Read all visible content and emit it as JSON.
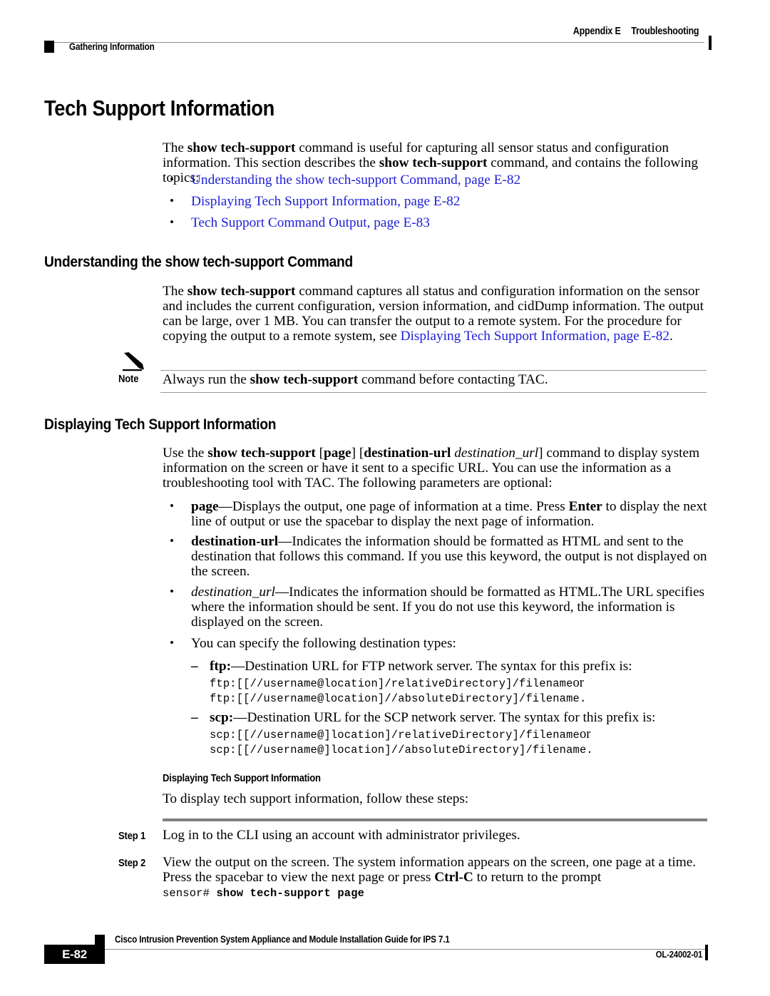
{
  "header": {
    "left_marker": "square-marker",
    "left_text": "Gathering Information",
    "right_appendix": "Appendix E",
    "right_title": "Troubleshooting"
  },
  "title": "Tech Support Information",
  "intro": {
    "line1_a": "The ",
    "line1_b": "show tech-support",
    "line1_c": " command is useful for capturing all sensor status and configuration information. This section describes the ",
    "line1_d": "show tech-support",
    "line1_e": " command, and contains the following topics:"
  },
  "topic_links": [
    "Understanding the show tech-support Command, page E-82",
    "Displaying Tech Support Information, page E-82",
    "Tech Support Command Output, page E-83"
  ],
  "section_understanding": {
    "heading": "Understanding the show tech-support Command",
    "p_a": "The ",
    "p_b": "show tech-support",
    "p_c": " command captures all status and configuration information on the sensor and includes the current configuration, version information, and cidDump information. The output can be large, over 1 MB. You can transfer the output to a remote system. For the procedure for copying the output to a remote system, see ",
    "p_link": "Displaying Tech Support Information, page E-82",
    "p_d": "."
  },
  "note": {
    "label": "Note",
    "icon": "pencil-icon",
    "text_a": "Always run the ",
    "text_b": "show tech-support",
    "text_c": " command before contacting TAC."
  },
  "section_displaying": {
    "heading": "Displaying Tech Support Information",
    "p_a": "Use the ",
    "p_b": "show tech-support",
    "p_c": " [",
    "p_d": "page",
    "p_e": "] [",
    "p_f": "destination-url",
    "p_g": " ",
    "p_h": "destination_url",
    "p_i": "] command to display system information on the screen or have it sent to a specific URL. You can use the information as a troubleshooting tool with TAC. The following parameters are optional:"
  },
  "params": [
    {
      "term": "page",
      "term_style": "bold",
      "desc": "—Displays the output, one page of information at a time. Press ",
      "desc_bold": "Enter",
      "desc_tail": " to display the next line of output or use the spacebar to display the next page of information."
    },
    {
      "term": "destination-url",
      "term_style": "bold",
      "desc": "—Indicates the information should be formatted as HTML and sent to the destination that follows this command. If you use this keyword, the output is not displayed on the screen."
    },
    {
      "term": "destination_url",
      "term_style": "italic",
      "desc": "—Indicates the information should be formatted as HTML.The URL specifies where the information should be sent. If you do not use this keyword, the information is displayed on the screen."
    }
  ],
  "destination_types_intro": "You can specify the following destination types:",
  "destination_types": [
    {
      "term": "ftp:",
      "desc": "—Destination URL for FTP network server. The syntax for this prefix is:",
      "code1": "ftp:[[//username@location]/relativeDirectory]/filename",
      "code1_tail": "or",
      "code2": "ftp:[[//username@location]//absoluteDirectory]/filename."
    },
    {
      "term": "scp:",
      "desc": "—Destination URL for the SCP network server. The syntax for this prefix is:",
      "code1": "scp:[[//username@]location]/relativeDirectory]/filename",
      "code1_tail": "or",
      "code2": "scp:[[//username@]location]//absoluteDirectory]/filename."
    }
  ],
  "procedure": {
    "heading": "Displaying Tech Support Information",
    "intro": "To display tech support information, follow these steps:",
    "steps": [
      {
        "label": "Step 1",
        "text": "Log in to the CLI using an account with administrator privileges."
      },
      {
        "label": "Step 2",
        "text_a": "View the output on the screen. The system information appears on the screen, one page at a time. Press the spacebar to view the next page or press ",
        "text_bold": "Ctrl-C",
        "text_b": " to return to the prompt",
        "code_prompt": "sensor# ",
        "code_cmd": "show tech-support page"
      }
    ]
  },
  "footer": {
    "page_number": "E-82",
    "doc_title": "Cisco Intrusion Prevention System Appliance and Module Installation Guide for IPS 7.1",
    "doc_id": "OL-24002-01"
  }
}
